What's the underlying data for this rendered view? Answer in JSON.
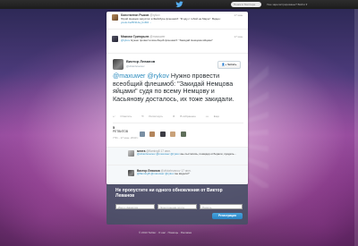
{
  "nav": {
    "search_placeholder": "Поиск в Твиттере",
    "signin_text": "Уже зарегистрированы? Войти ▾"
  },
  "context_tweets": [
    {
      "name": "Константин Рыков",
      "handle": "@rykov",
      "time": "17 июн.",
      "text_prefix": "Юрий Немцов запустил в Фейсбуке флешмоб: \"Я иду с тобой на Марш\". Видео: ",
      "link": "youtu.be/fD31Ja_bnM4 ..."
    },
    {
      "name": "Максим Григорьев",
      "handle": "@maxuwer",
      "time": "17 июн.",
      "link": "@rykov",
      "text_suffix": " Нужно провести всеобщий флешмоб: \"Закидай Немцова яйцами\""
    }
  ],
  "main_tweet": {
    "name": "Виктор Леванов",
    "handle": "@viktorlevanov",
    "follow_label": "Читать",
    "mention1": "@maxuwer",
    "mention2": "@rykov",
    "text_part1": " Нужно провести всеобщий флешмоб: \"Закидай Немцова яйцами\"",
    "text_part2": " судя по всему Немцову и Касьянову досталось, их тоже закидали.",
    "actions": [
      "Ответить",
      "Ретвитнуть",
      "В избранное",
      "Ещё"
    ],
    "retweets_count": "5",
    "retweets_label": "РЕТВИТОВ",
    "date": "7:51 - 17 июн. 2013 г."
  },
  "replies": [
    {
      "name": "мента",
      "handle": "@flaming8",
      "time": "17 июн.",
      "mentions": "@viktorlevanov @maxuwer @rykov",
      "text": " мы льстились, помидор отберали, продать..."
    },
    {
      "name": "Виктор Леванов",
      "handle": "@viktorlevanov",
      "time": "17 июн.",
      "mentions": "@flaming8 @maxuwer @rykov",
      "text": " вы видели?"
    }
  ],
  "signup": {
    "title": "Не пропустите ни одного обновления от Виктор Леванов",
    "name_placeholder": "Имя и фамилия",
    "email_placeholder": "Электронная почта",
    "password_placeholder": "Пароль",
    "button_label": "Регистрация"
  },
  "footer": "© 2013 Twitter · О нас · Помощь · Реклама"
}
